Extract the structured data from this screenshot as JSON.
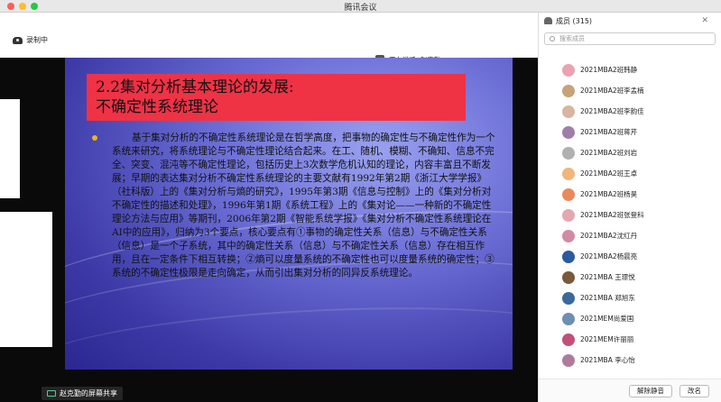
{
  "window": {
    "title": "腾讯会议"
  },
  "toolbar": {
    "recording_label": "录制中",
    "speaking_label": "正在讲话: 赵克勤;"
  },
  "slide": {
    "title_line1": "2.2集对分析基本理论的发展:",
    "title_line2": "不确定性系统理论",
    "body": "基于集对分析的不确定性系统理论是在哲学高度，把事物的确定性与不确定性作为一个系统来研究，将系统理论与不确定性理论结合起来。在工、随机、模糊、不确知、信息不完全、突变、混沌等不确定性理论，包括历史上3次数学危机认知的理论，内容丰富且不断发展；早期的表达集对分析不确定性系统理论的主要文献有1992年第2期《浙江大学学报》（社科版）上的《集对分析与熵的研究》，1995年第3期《信息与控制》上的《集对分析对不确定性的描述和处理》，1996年第1期《系统工程》上的《集对论——一种新的不确定性理论方法与应用》等期刊，2006年第2期《智能系统学报》《集对分析不确定性系统理论在AI中的应用》，归纳为3个要点，核心要点有①事物的确定性关系（信息）与不确定性关系（信息）是一个子系统，其中的确定性关系（信息）与不确定性关系（信息）存在相互作用，且在一定条件下相互转换；②熵可以度量系统的不确定性也可以度量系统的确定性；③系统的不确定性极限是走向确定，从而引出集对分析的同异反系统理论。"
  },
  "share": {
    "label": "赵克勤的屏幕共享"
  },
  "panel": {
    "header": "成员 (315)",
    "search_placeholder": "搜索成员",
    "members": [
      {
        "name": "2021MBA2班韩静",
        "color": "#e9a3b3"
      },
      {
        "name": "2021MBA2班李孟楠",
        "color": "#c8a27a"
      },
      {
        "name": "2021MBA2班李韵佳",
        "color": "#d7b5a1"
      },
      {
        "name": "2021MBA2班蒋芹",
        "color": "#9e7fa8"
      },
      {
        "name": "2021MBA2班刘岩",
        "color": "#b0b0b0"
      },
      {
        "name": "2021MBA2班王卓",
        "color": "#f0b67a"
      },
      {
        "name": "2021MBA2班杨昊",
        "color": "#e88a5d"
      },
      {
        "name": "2021MBA2班张登科",
        "color": "#e4a8b0"
      },
      {
        "name": "2021MBA2沈红丹",
        "color": "#d38aa5"
      },
      {
        "name": "2021MBA2杨晨亮",
        "color": "#2c5aa0"
      },
      {
        "name": "2021MBA 王璟悦",
        "color": "#7a5a3a"
      },
      {
        "name": "2021MBA 郑旭东",
        "color": "#3a6a9a"
      },
      {
        "name": "2021MEM尚爱国",
        "color": "#6d8fb3"
      },
      {
        "name": "2021MEM许丽丽",
        "color": "#c0507a"
      },
      {
        "name": "2021MBA 李心怡",
        "color": "#b07a9a"
      }
    ],
    "mute_button": "解除静音",
    "rename_button": "改名"
  }
}
